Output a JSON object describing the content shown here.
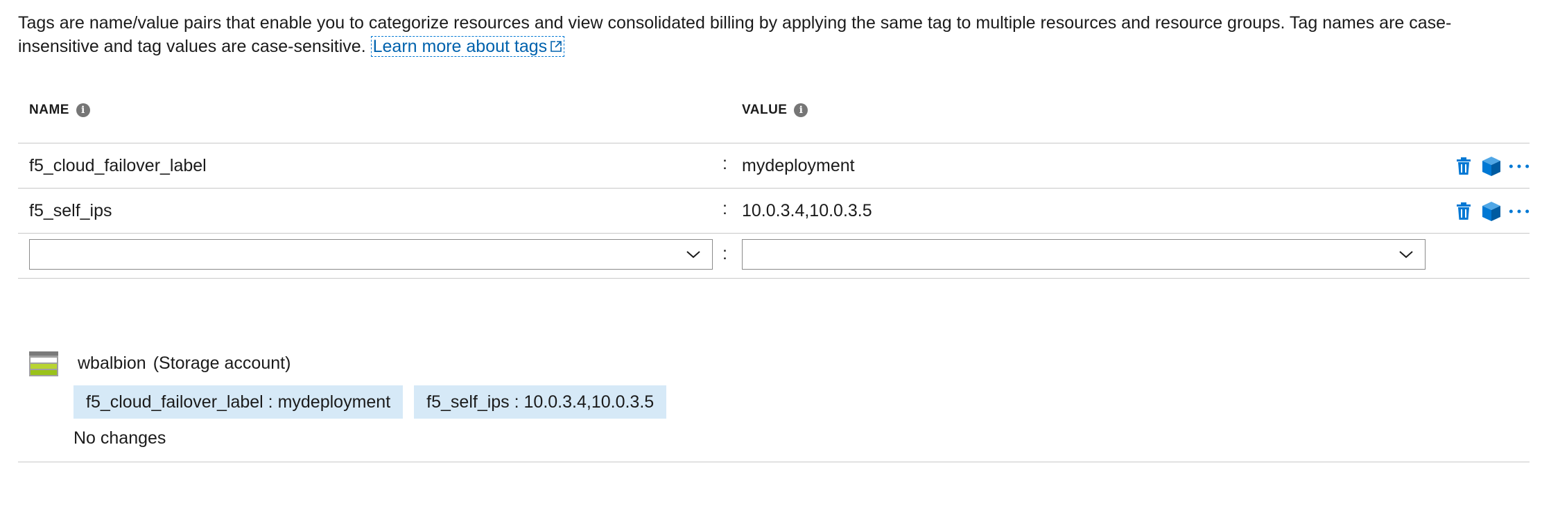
{
  "intro": {
    "text": "Tags are name/value pairs that enable you to categorize resources and view consolidated billing by applying the same tag to multiple resources and resource groups. Tag names are case-insensitive and tag values are case-sensitive. ",
    "link_label": "Learn more about tags",
    "link_icon": "external-link-icon"
  },
  "table": {
    "headers": {
      "name": "NAME",
      "value": "VALUE"
    },
    "separator": ":",
    "rows": [
      {
        "name": "f5_cloud_failover_label",
        "value": "mydeployment"
      },
      {
        "name": "f5_self_ips",
        "value": "10.0.3.4,10.0.3.5"
      }
    ],
    "new_row": {
      "name": "",
      "value": ""
    },
    "row_actions": [
      "delete-icon",
      "apply-to-resources-icon",
      "more-icon"
    ]
  },
  "resource": {
    "icon": "storage-account-icon",
    "name": "wbalbion",
    "type": "(Storage account)",
    "tags": [
      "f5_cloud_failover_label : mydeployment",
      "f5_self_ips : 10.0.3.4,10.0.3.5"
    ],
    "status": "No changes"
  },
  "colors": {
    "link": "#0062ad",
    "icon_blue": "#0078d4",
    "pill_bg": "#d6e9f7",
    "divider": "#c8c8c8"
  }
}
